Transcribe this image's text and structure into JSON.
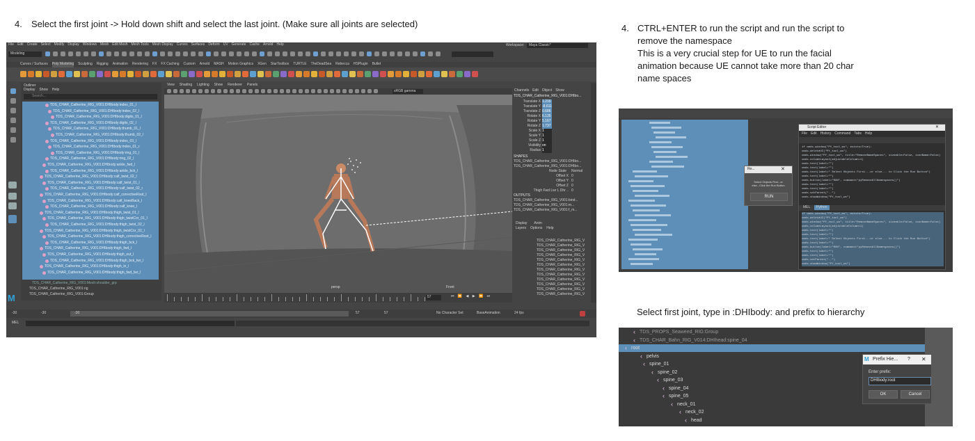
{
  "instructions": {
    "step_left_num": "4.",
    "step_left": "Select the first joint -> Hold down shift and select the last joint. (Make sure all joints are selected)",
    "step_right_num": "4.",
    "step_right_lines": [
      "CTRL+ENTER to run the script and run the script to",
      "remove the namespace",
      "This is a very crucial step for UE to run the facial",
      "animation because UE cannot take more than 20 char",
      "name spaces"
    ],
    "prefix_note": "Select first joint, type in :DHIbody: and prefix to hierarchy"
  },
  "maya_main": {
    "menu": [
      "File",
      "Edit",
      "Create",
      "Select",
      "Modify",
      "Display",
      "Windows",
      "Mesh",
      "Edit Mesh",
      "Mesh Tools",
      "Mesh Display",
      "Curves",
      "Surfaces",
      "Deform",
      "UV",
      "Generate",
      "Cache",
      "Arnold",
      "Help"
    ],
    "workspace_label": "Workspace:",
    "workspace_value": "Maya Classic*",
    "mode": "Modeling",
    "shelf_tabs": [
      "Curves / Surfaces",
      "Poly Modeling",
      "Sculpting",
      "Rigging",
      "Animation",
      "Rendering",
      "FX",
      "FX Caching",
      "Custom",
      "Arnold",
      "MASH",
      "Motion Graphics",
      "XGen",
      "StarToolbox",
      "TURTLE",
      "TheDeadSea",
      "Rebecca",
      "HSPlugin",
      "Bullet"
    ],
    "outliner_title": "Outliner",
    "outliner_menu": [
      "Display",
      "Show",
      "Help"
    ],
    "outliner_search": "Search...",
    "outliner_rows": [
      "TDS_CHAR_Catherine_RIG_V001:DHIbody:index_01_l",
      "TDS_CHAR_Catherine_RIG_V001:DHIbody:index_02_l",
      "TDS_CHAR_Catherine_RIG_V001:DHIbody:digits_01_l",
      "TDS_CHAR_Catherine_RIG_V001:DHIbody:digits_02_l",
      "TDS_CHAR_Catherine_RIG_V001:DHIbody:thumb_01_l",
      "TDS_CHAR_Catherine_RIG_V001:DHIbody:thumb_02_l",
      "TDS_CHAR_Catherine_RIG_V001:DHIbody:index_03_l",
      "TDS_CHAR_Catherine_RIG_V001:DHIbody:index_01_r",
      "TDS_CHAR_Catherine_RIG_V001:DHIbody:ring_01_l",
      "TDS_CHAR_Catherine_RIG_V001:DHIbody:ring_02_l",
      "TDS_CHAR_Catherine_RIG_V001:DHIbody:ankle_fwd_l",
      "TDS_CHAR_Catherine_RIG_V001:DHIbody:ankle_bck_l",
      "TDS_CHAR_Catherine_RIG_V001:DHIbody:calf_twist_02_l",
      "TDS_CHAR_Catherine_RIG_V001:DHIbody:calf_twist_01_l",
      "TDS_CHAR_Catherine_RIG_V001:DHIbody:calf_twist_02_r",
      "TDS_CHAR_Catherine_RIG_V001:DHIbody:calf_correctiveRoot_l",
      "TDS_CHAR_Catherine_RIG_V001:DHIbody:calf_kneeBack_l",
      "TDS_CHAR_Catherine_RIG_V001:DHIbody:calf_knee_l",
      "TDS_CHAR_Catherine_RIG_V001:DHIbody:thigh_twist_01_l",
      "TDS_CHAR_Catherine_RIG_V001:DHIbody:thigh_twistCor_01_l",
      "TDS_CHAR_Catherine_RIG_V001:DHIbody:thigh_twist_02_l",
      "TDS_CHAR_Catherine_RIG_V001:DHIbody:thigh_twistCor_02_l",
      "TDS_CHAR_Catherine_RIG_V001:DHIbody:thigh_correctiveRoot_l",
      "TDS_CHAR_Catherine_RIG_V001:DHIbody:thigh_bck_l",
      "TDS_CHAR_Catherine_RIG_V001:DHIbody:thigh_fwd_l",
      "TDS_CHAR_Catherine_RIG_V001:DHIbody:thigh_out_l",
      "TDS_CHAR_Catherine_RIG_V001:DHIbody:thigh_bck_lwr_l",
      "TDS_CHAR_Catherine_RIG_V001:DHIbody:thigh_in_l",
      "TDS_CHAR_Catherine_RIG_V001:DHIbody:thigh_fwd_lwr_l"
    ],
    "outliner_tail": [
      "TDS_CHAR_Catherine_RIG_V001:Mesh:shoulder_grp",
      "TDS_CHAR_Catherine_RIG_V001:rig",
      "TDS_CHAR_Catherine_RIG_V001:Group"
    ],
    "viewport_menu": [
      "View",
      "Shading",
      "Lighting",
      "Show",
      "Renderer",
      "Panels"
    ],
    "viewport_label": "persp",
    "viewport_label2": "Front",
    "color_space": "sRGB gamma",
    "channel_menu": [
      "Channels",
      "Edit",
      "Object",
      "Show"
    ],
    "channel_object": "TDS_CHAR_Catherine_RIG_V001:DHIbo...",
    "channels": [
      {
        "name": "Translate X",
        "value": "1.216"
      },
      {
        "name": "Translate Y",
        "value": "-8.611"
      },
      {
        "name": "Translate Z",
        "value": "0.686"
      },
      {
        "name": "Rotate X",
        "value": "6.135"
      },
      {
        "name": "Rotate Y",
        "value": "5.167"
      },
      {
        "name": "Rotate Z",
        "value": "1.737"
      },
      {
        "name": "Scale X",
        "value": "1"
      },
      {
        "name": "Scale Y",
        "value": "1"
      },
      {
        "name": "Scale Z",
        "value": "1"
      },
      {
        "name": "Visibility",
        "value": "on"
      },
      {
        "name": "Radius",
        "value": "1"
      }
    ],
    "shapes_label": "SHAPES",
    "shapes": [
      "TDS_CHAR_Catherine_RIG_V001:DHIbo...",
      "TDS_CHAR_Catherine_RIG_V001:DHIbo..."
    ],
    "node_state": "Node State",
    "node_state_value": "Normal",
    "offsets": [
      {
        "name": "Offset X",
        "value": "0"
      },
      {
        "name": "Offset Y",
        "value": "0"
      },
      {
        "name": "Offset Z",
        "value": "0"
      }
    ],
    "offset_extra": {
      "name": "Thigh Fwd Lwr L Dhr ..",
      "value": "0"
    },
    "outputs_label": "OUTPUTS",
    "outputs": [
      "TDS_CHAR_Catherine_RIG_V001:bind...",
      "TDS_CHAR_Catherine_RIG_V001:m...",
      "TDS_CHAR_Catherine_RIG_V001:f_m..."
    ],
    "layer_tabs": [
      "Display",
      "Anim"
    ],
    "layer_menu": [
      "Layers",
      "Options",
      "Help"
    ],
    "layers": [
      "TDS_CHAR_Catherine_RIG_V",
      "TDS_CHAR_Catherine_RIG_V",
      "TDS_CHAR_Catherine_RIG_V",
      "TDS_CHAR_Catherine_RIG_V",
      "TDS_CHAR_Catherine_RIG_V",
      "TDS_CHAR_Catherine_RIG_V",
      "TDS_CHAR_Catherine_RIG_V",
      "TDS_CHAR_Catherine_RIG_V",
      "TDS_CHAR_Catherine_RIG_V",
      "TDS_CHAR_Catherine_RIG_V",
      "TDS_CHAR_Catherine_RIG_V",
      "TDS_CHAR_Catherine_RIG_V"
    ],
    "time_start": "-30",
    "time_start2": "-30",
    "time_field": "-30",
    "time_end": "57",
    "time_end2": "57",
    "time_current": "57",
    "no_char_set": "No Character Set",
    "anim_layer": "BaseAnimation",
    "fps": "24 fps",
    "mel_label": "MEL",
    "accent": "#5b8fb9",
    "selection": "#5d8fb8"
  },
  "script_shot": {
    "window_title": "Script Editor",
    "menu": [
      "File",
      "Edit",
      "History",
      "Command",
      "Tabs",
      "Help"
    ],
    "popup_title": "Re...",
    "popup_text": "Select Objects First...or else...Click the Run Button",
    "popup_button": "RUN",
    "code_lines": [
      "if cmds.window(\"PY_tool_ws\", exists=True):",
      "    cmds.deleteUI(\"PY_tool_ws\")",
      "cmds.window(\"PY_tool_ws\", title=\"RemoveNameSpaces\", sizeable=False, iconName=False)",
      "cmds.columnLayout(adjustableColumn=1)",
      "cmds.text(label=\"\")",
      "cmds.text(label=\"\")",
      "cmds.text(label=\"     Select Objects First...or else... to Click the Run Button\")",
      "cmds.text(label=\"\")",
      "cmds.button(label=\"RUN\", command=\"pyRemoveAllNamespaces()\")",
      "cmds.text(label=\"\")",
      "cmds.text(label=\"\")",
      "cmds.setParent(\"..\")",
      "cmds.showWindow(\"PY_tool_ws\")"
    ],
    "tab_labels": [
      "MEL",
      "Python"
    ]
  },
  "prefix_shot": {
    "rows": [
      "TDS_PROPS_Seaweed_RIG:Group",
      "TDS_CHAR_Bahn_RIG_V014:DHIhead:spine_04",
      "root",
      "pelvis",
      "spine_01",
      "spine_02",
      "spine_03",
      "spine_04",
      "spine_05",
      "neck_01",
      "neck_02",
      "head"
    ],
    "dialog_title": "Prefix Hie...",
    "dialog_help": "?",
    "dialog_close": "✕",
    "dialog_label": "Enter prefix:",
    "dialog_value": "DHIbody:root",
    "ok": "OK",
    "cancel": "Cancel"
  }
}
